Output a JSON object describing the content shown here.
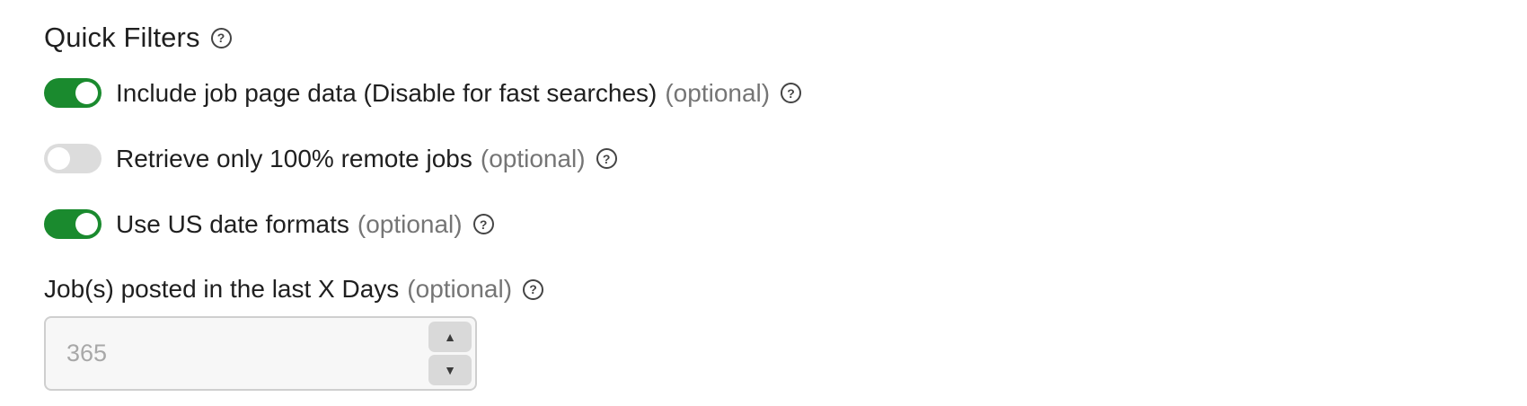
{
  "section": {
    "title": "Quick Filters"
  },
  "toggles": [
    {
      "label": "Include job page data (Disable for fast searches)",
      "optional": "(optional)",
      "on": true
    },
    {
      "label": "Retrieve only 100% remote jobs",
      "optional": "(optional)",
      "on": false
    },
    {
      "label": "Use US date formats",
      "optional": "(optional)",
      "on": true
    }
  ],
  "days_field": {
    "label": "Job(s) posted in the last X Days",
    "optional": "(optional)",
    "value": "365"
  },
  "icons": {
    "help": "question-circle-icon",
    "increment": "caret-up-icon",
    "decrement": "caret-down-icon"
  },
  "colors": {
    "toggle_on": "#1a8a2e",
    "toggle_off": "#dcdcdc",
    "optional_text": "#757575"
  }
}
